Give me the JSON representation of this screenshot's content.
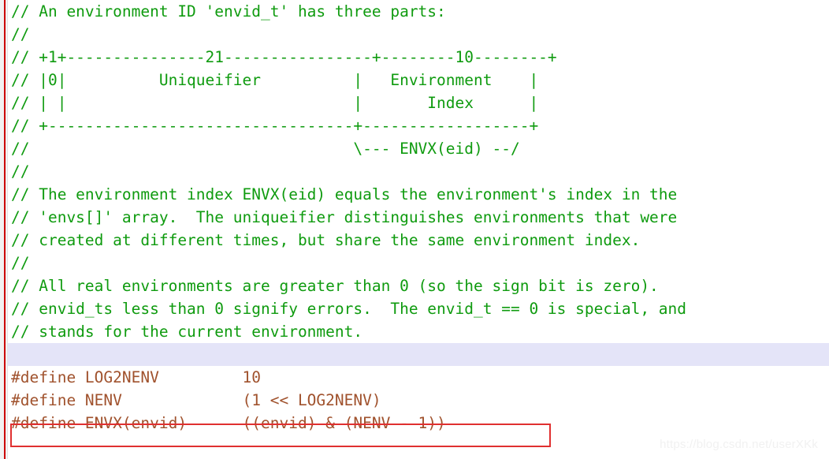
{
  "editor": {
    "language": "c",
    "colors": {
      "comment": "#0f9b0f",
      "macro": "#a0522d",
      "cursorline": "#e4e4f8",
      "gutter": "#f2f2f2",
      "gutter_rule": "#cc0000",
      "annotation_box": "#e03030",
      "background": "#ffffff",
      "watermark": "#f1f1f1"
    },
    "lines": [
      {
        "id": 1,
        "kind": "comment",
        "text": "// An environment ID 'envid_t' has three parts:"
      },
      {
        "id": 2,
        "kind": "comment",
        "text": "//"
      },
      {
        "id": 3,
        "kind": "comment",
        "text": "// +1+---------------21----------------+--------10--------+"
      },
      {
        "id": 4,
        "kind": "comment",
        "text": "// |0|          Uniqueifier          |   Environment    |"
      },
      {
        "id": 5,
        "kind": "comment",
        "text": "// | |                               |       Index      |"
      },
      {
        "id": 6,
        "kind": "comment",
        "text": "// +---------------------------------+------------------+"
      },
      {
        "id": 7,
        "kind": "comment",
        "text": "//                                   \\--- ENVX(eid) --/"
      },
      {
        "id": 8,
        "kind": "comment",
        "text": "//"
      },
      {
        "id": 9,
        "kind": "comment",
        "text": "// The environment index ENVX(eid) equals the environment's index in the"
      },
      {
        "id": 10,
        "kind": "comment",
        "text": "// 'envs[]' array.  The uniqueifier distinguishes environments that were"
      },
      {
        "id": 11,
        "kind": "comment",
        "text": "// created at different times, but share the same environment index."
      },
      {
        "id": 12,
        "kind": "comment",
        "text": "//"
      },
      {
        "id": 13,
        "kind": "comment",
        "text": "// All real environments are greater than 0 (so the sign bit is zero)."
      },
      {
        "id": 14,
        "kind": "comment",
        "text": "// envid_ts less than 0 signify errors.  The envid_t == 0 is special, and"
      },
      {
        "id": 15,
        "kind": "comment",
        "text": "// stands for the current environment."
      },
      {
        "id": 16,
        "kind": "blank",
        "text": " ",
        "cursorline": true
      },
      {
        "id": 17,
        "kind": "macro",
        "text": "#define LOG2NENV         10"
      },
      {
        "id": 18,
        "kind": "macro",
        "text": "#define NENV             (1 << LOG2NENV)"
      },
      {
        "id": 19,
        "kind": "macro",
        "text": "#define ENVX(envid)      ((envid) & (NENV - 1))",
        "annotated": true
      }
    ],
    "macros": [
      {
        "name": "LOG2NENV",
        "value": "10"
      },
      {
        "name": "NENV",
        "value": "(1 << LOG2NENV)"
      },
      {
        "name": "ENVX(envid)",
        "value": "((envid) & (NENV - 1))"
      }
    ],
    "annotation": {
      "target_line": 19,
      "shape": "rectangle",
      "color": "#e03030"
    }
  },
  "watermark": {
    "text": "https://blog.csdn.net/userXKk"
  }
}
